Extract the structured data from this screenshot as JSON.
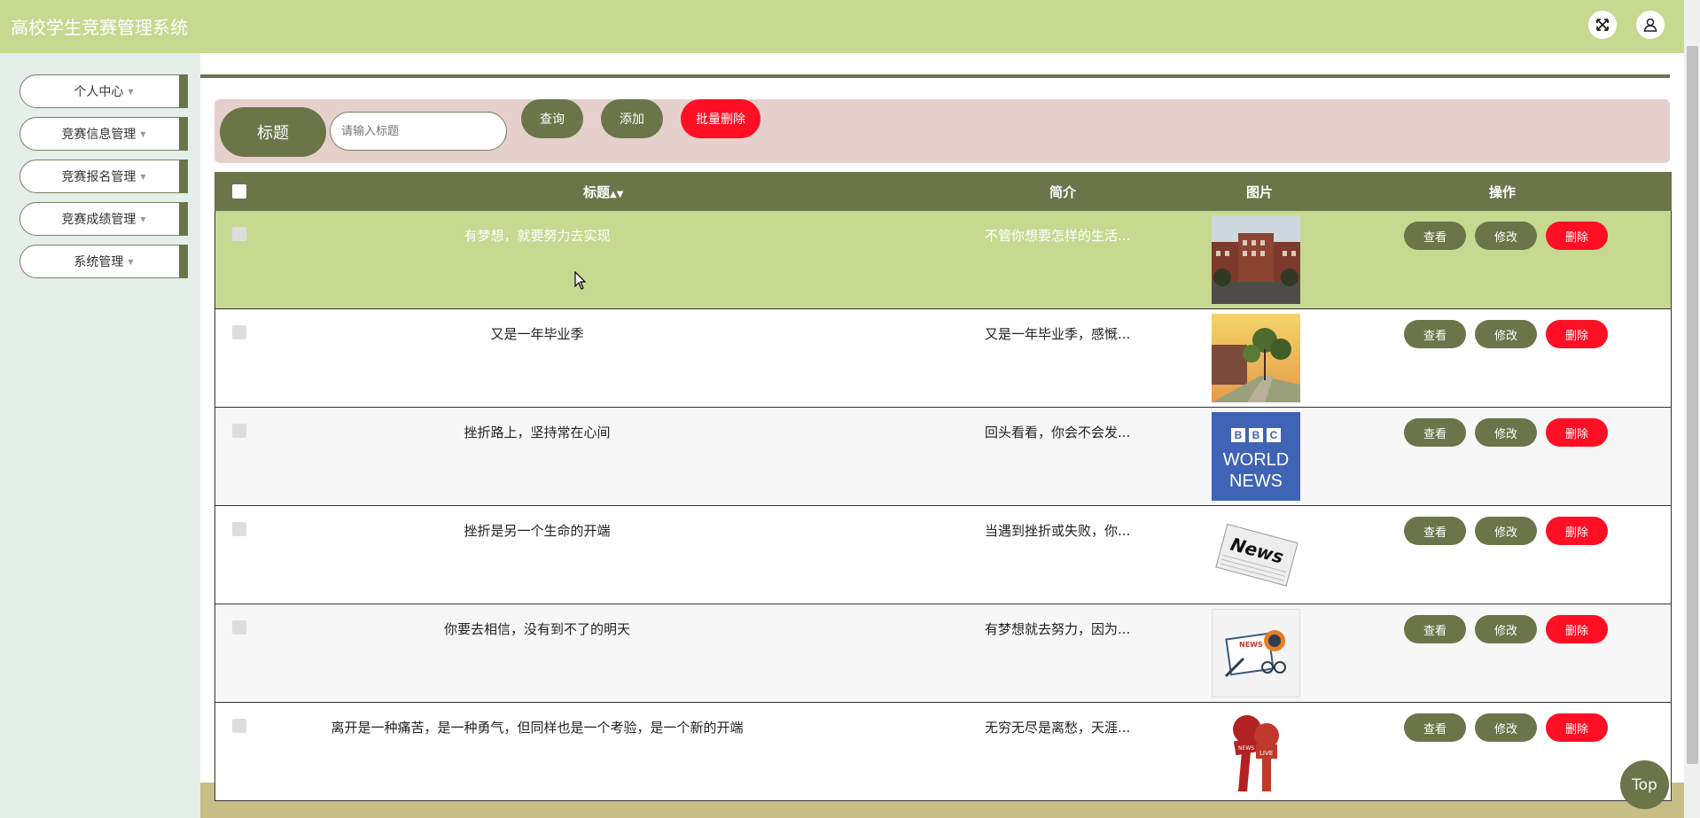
{
  "header": {
    "title": "高校学生竞赛管理系统",
    "fullscreen_icon": "expand-icon",
    "user_icon": "user-icon"
  },
  "sidebar": {
    "items": [
      {
        "label": "个人中心"
      },
      {
        "label": "竞赛信息管理"
      },
      {
        "label": "竞赛报名管理"
      },
      {
        "label": "竞赛成绩管理"
      },
      {
        "label": "系统管理"
      }
    ]
  },
  "search": {
    "label": "标题",
    "placeholder": "请输入标题",
    "query_label": "查询",
    "add_label": "添加",
    "batch_delete_label": "批量删除"
  },
  "table": {
    "columns": {
      "title": "标题",
      "intro": "简介",
      "image": "图片",
      "action": "操作"
    },
    "actions": {
      "view": "查看",
      "edit": "修改",
      "delete": "删除"
    },
    "rows": [
      {
        "title": "有梦想，就要努力去实现",
        "intro": "不管你想要怎样的生活..."
      },
      {
        "title": "又是一年毕业季",
        "intro": "又是一年毕业季，感慨..."
      },
      {
        "title": "挫折路上，坚持常在心间",
        "intro": "回头看看，你会不会发..."
      },
      {
        "title": "挫折是另一个生命的开端",
        "intro": "当遇到挫折或失败，你..."
      },
      {
        "title": "你要去相信，没有到不了的明天",
        "intro": "有梦想就去努力，因为..."
      },
      {
        "title": "离开是一种痛苦，是一种勇气，但同样也是一个考验，是一个新的开端",
        "intro": "无穷无尽是离愁，天涯..."
      }
    ]
  },
  "thumbnail_texts": {
    "bbc": [
      "BBC",
      "WORLD",
      "NEWS"
    ],
    "news": "News",
    "news_small": "NEWS",
    "live": "LIVE"
  },
  "top_button": "Top",
  "colors": {
    "topbar": "#c7d991",
    "olive": "#6b7549",
    "danger": "#ff0f24",
    "searchbar": "#e6d0cc"
  }
}
